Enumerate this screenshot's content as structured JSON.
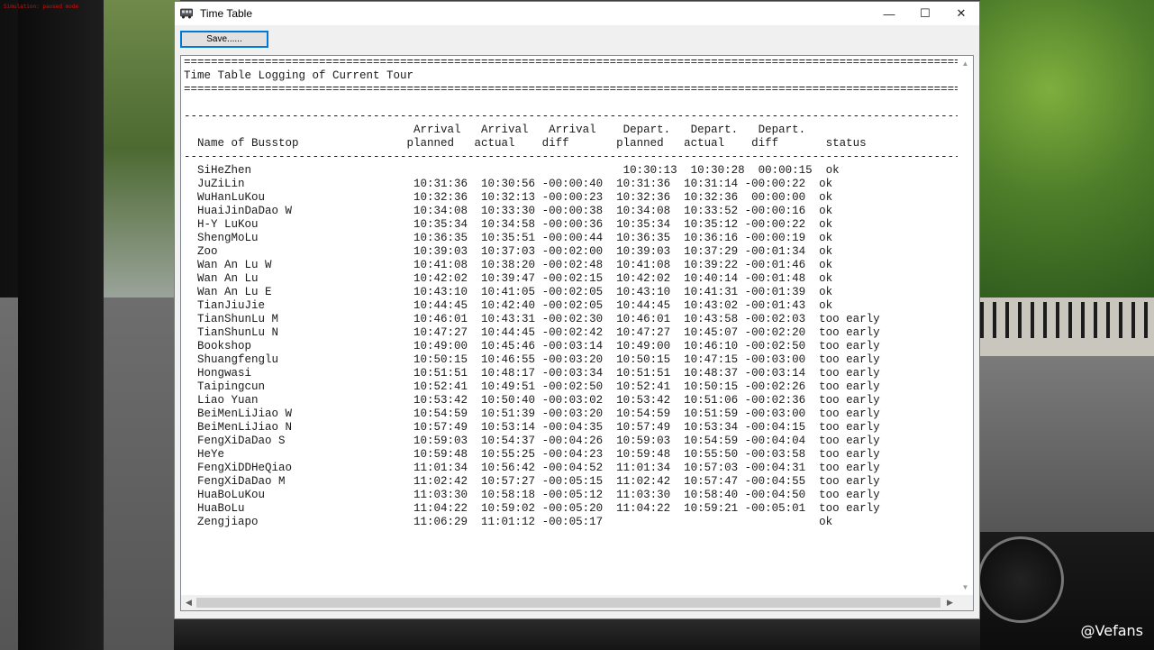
{
  "overlay": {
    "fps_text": "Simulation: paused mode"
  },
  "watermark": "@Vefans",
  "window": {
    "title": "Time Table",
    "controls": {
      "minimize": "—",
      "maximize": "☐",
      "close": "✕"
    }
  },
  "toolbar": {
    "save_label": "Save......"
  },
  "log": {
    "lines": [
      "======================================================================================================================",
      "Time Table Logging of Current Tour",
      "======================================================================================================================",
      "",
      "----------------------------------------------------------------------------------------------------------------------",
      "                                  Arrival   Arrival   Arrival    Depart.   Depart.   Depart.",
      "  Name of Busstop                planned   actual    diff       planned   actual    diff       status",
      "----------------------------------------------------------------------------------------------------------------------",
      "  SiHeZhen                                                       10:30:13  10:30:28  00:00:15  ok",
      "  JuZiLin                         10:31:36  10:30:56 -00:00:40  10:31:36  10:31:14 -00:00:22  ok",
      "  WuHanLuKou                      10:32:36  10:32:13 -00:00:23  10:32:36  10:32:36  00:00:00  ok",
      "  HuaiJinDaDao W                  10:34:08  10:33:30 -00:00:38  10:34:08  10:33:52 -00:00:16  ok",
      "  H-Y LuKou                       10:35:34  10:34:58 -00:00:36  10:35:34  10:35:12 -00:00:22  ok",
      "  ShengMoLu                       10:36:35  10:35:51 -00:00:44  10:36:35  10:36:16 -00:00:19  ok",
      "  Zoo                             10:39:03  10:37:03 -00:02:00  10:39:03  10:37:29 -00:01:34  ok",
      "  Wan An Lu W                     10:41:08  10:38:20 -00:02:48  10:41:08  10:39:22 -00:01:46  ok",
      "  Wan An Lu                       10:42:02  10:39:47 -00:02:15  10:42:02  10:40:14 -00:01:48  ok",
      "  Wan An Lu E                     10:43:10  10:41:05 -00:02:05  10:43:10  10:41:31 -00:01:39  ok",
      "  TianJiuJie                      10:44:45  10:42:40 -00:02:05  10:44:45  10:43:02 -00:01:43  ok",
      "  TianShunLu M                    10:46:01  10:43:31 -00:02:30  10:46:01  10:43:58 -00:02:03  too early",
      "  TianShunLu N                    10:47:27  10:44:45 -00:02:42  10:47:27  10:45:07 -00:02:20  too early",
      "  Bookshop                        10:49:00  10:45:46 -00:03:14  10:49:00  10:46:10 -00:02:50  too early",
      "  Shuangfenglu                    10:50:15  10:46:55 -00:03:20  10:50:15  10:47:15 -00:03:00  too early",
      "  Hongwasi                        10:51:51  10:48:17 -00:03:34  10:51:51  10:48:37 -00:03:14  too early",
      "  Taipingcun                      10:52:41  10:49:51 -00:02:50  10:52:41  10:50:15 -00:02:26  too early",
      "  Liao Yuan                       10:53:42  10:50:40 -00:03:02  10:53:42  10:51:06 -00:02:36  too early",
      "  BeiMenLiJiao W                  10:54:59  10:51:39 -00:03:20  10:54:59  10:51:59 -00:03:00  too early",
      "  BeiMenLiJiao N                  10:57:49  10:53:14 -00:04:35  10:57:49  10:53:34 -00:04:15  too early",
      "  FengXiDaDao S                   10:59:03  10:54:37 -00:04:26  10:59:03  10:54:59 -00:04:04  too early",
      "  HeYe                            10:59:48  10:55:25 -00:04:23  10:59:48  10:55:50 -00:03:58  too early",
      "  FengXiDDHeQiao                  11:01:34  10:56:42 -00:04:52  11:01:34  10:57:03 -00:04:31  too early",
      "  FengXiDaDao M                   11:02:42  10:57:27 -00:05:15  11:02:42  10:57:47 -00:04:55  too early",
      "  HuaBoLuKou                      11:03:30  10:58:18 -00:05:12  11:03:30  10:58:40 -00:04:50  too early",
      "  HuaBoLu                         11:04:22  10:59:02 -00:05:20  11:04:22  10:59:21 -00:05:01  too early",
      "  Zengjiapo                       11:06:29  11:01:12 -00:05:17                                ok"
    ]
  }
}
